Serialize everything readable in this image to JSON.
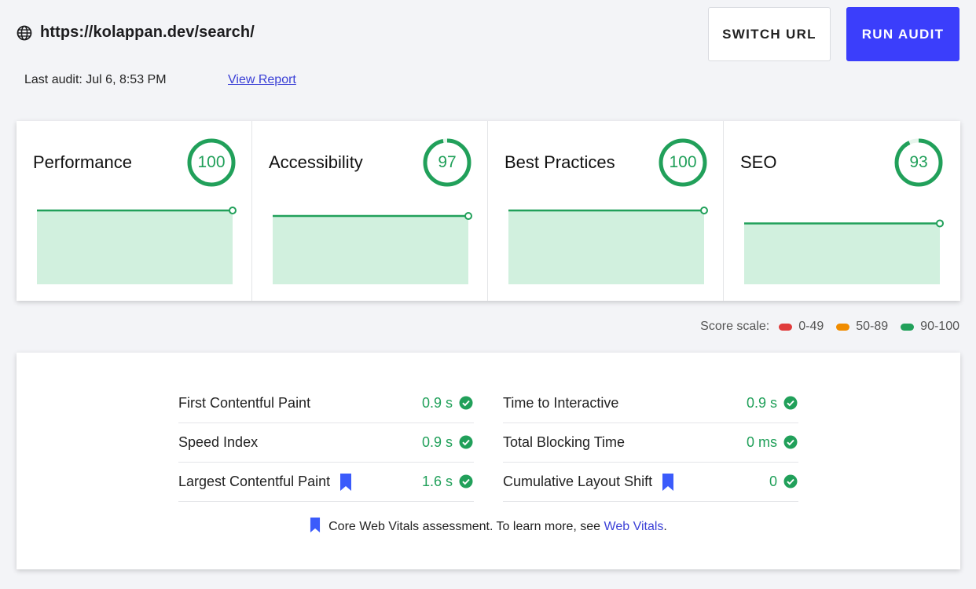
{
  "header": {
    "url": "https://kolappan.dev/search/",
    "last_audit": "Last audit: Jul 6, 8:53 PM",
    "view_report": "View Report",
    "switch_url_label": "SWITCH URL",
    "run_audit_label": "RUN AUDIT",
    "globe_icon": "globe-icon"
  },
  "colors": {
    "accent": "#3b3efb",
    "pass": "#21a05a",
    "pass_fill": "#d1f0de",
    "average": "#f08c00",
    "fail": "#e03c3c"
  },
  "scores": [
    {
      "label": "Performance",
      "score": "100",
      "value": 100
    },
    {
      "label": "Accessibility",
      "score": "97",
      "value": 97
    },
    {
      "label": "Best Practices",
      "score": "100",
      "value": 100
    },
    {
      "label": "SEO",
      "score": "93",
      "value": 93
    }
  ],
  "legend": {
    "label": "Score scale:",
    "ranges": [
      {
        "text": "0-49",
        "color": "#e03c3c"
      },
      {
        "text": "50-89",
        "color": "#f08c00"
      },
      {
        "text": "90-100",
        "color": "#21a05a"
      }
    ]
  },
  "metrics": {
    "left": [
      {
        "name": "First Contentful Paint",
        "value": "0.9 s",
        "core_vital": false
      },
      {
        "name": "Speed Index",
        "value": "0.9 s",
        "core_vital": false
      },
      {
        "name": "Largest Contentful Paint",
        "value": "1.6 s",
        "core_vital": true
      }
    ],
    "right": [
      {
        "name": "Time to Interactive",
        "value": "0.9 s",
        "core_vital": false
      },
      {
        "name": "Total Blocking Time",
        "value": "0 ms",
        "core_vital": false
      },
      {
        "name": "Cumulative Layout Shift",
        "value": "0",
        "core_vital": true
      }
    ],
    "note_text": "Core Web Vitals assessment. To learn more, see ",
    "note_link": "Web Vitals",
    "note_end": "."
  }
}
